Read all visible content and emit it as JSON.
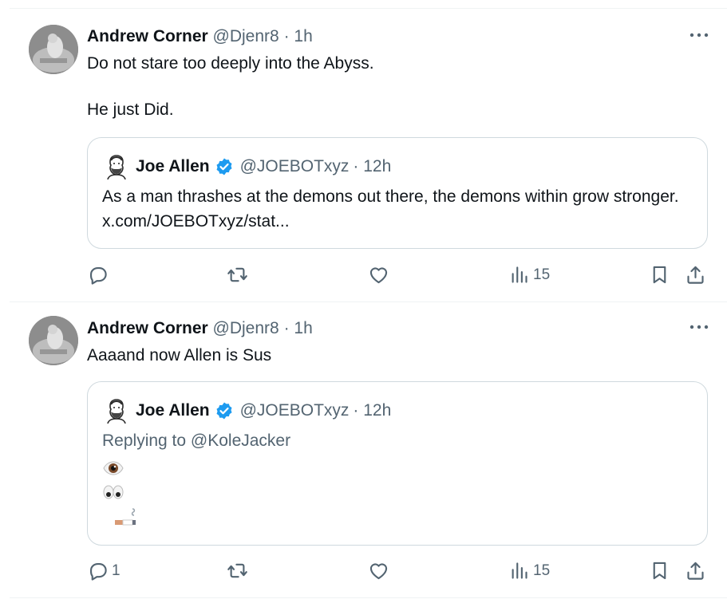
{
  "tweets": [
    {
      "author": "Andrew Corner",
      "handle": "@Djenr8",
      "time": "· 1h",
      "text": "Do not stare too deeply into the Abyss.\n\nHe just Did.",
      "quote": {
        "author": "Joe Allen",
        "handle": "@JOEBOTxyz",
        "time": "· 12h",
        "text": "As a man thrashes at the demons out there, the demons within grow stronger. x.com/JOEBOTxyz/stat..."
      },
      "actions": {
        "replies": "",
        "reposts": "",
        "likes": "",
        "views": "15"
      }
    },
    {
      "author": "Andrew Corner",
      "handle": "@Djenr8",
      "time": "· 1h",
      "text": "Aaaand now Allen is Sus",
      "quote": {
        "author": "Joe Allen",
        "handle": "@JOEBOTxyz",
        "time": "· 12h",
        "replying_prefix": "Replying to ",
        "replying_to": "@KoleJacker",
        "emojis": [
          "eye",
          "eyes",
          "smoking"
        ]
      },
      "actions": {
        "replies": "1",
        "reposts": "",
        "likes": "",
        "views": "15"
      }
    }
  ],
  "icons": [
    "more-icon",
    "reply-icon",
    "repost-icon",
    "like-icon",
    "views-icon",
    "bookmark-icon",
    "share-icon",
    "verified-icon"
  ],
  "colors": {
    "text": "#0f1419",
    "secondary": "#536471",
    "verified": "#1d9bf0",
    "border": "#cfd9de"
  }
}
